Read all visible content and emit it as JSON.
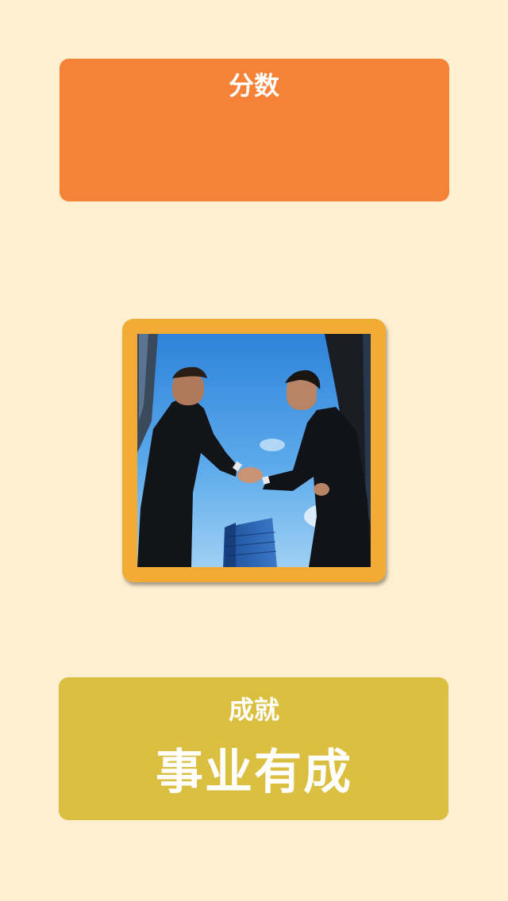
{
  "score_panel": {
    "title": "分数",
    "value": ""
  },
  "photo": {
    "icon": "handshake-photo"
  },
  "achievement_panel": {
    "title": "成就",
    "value": "事业有成"
  },
  "colors": {
    "background": "#feefd0",
    "score_card": "#f58237",
    "photo_frame": "#f2ac36",
    "achievement_card": "#dbbf41",
    "text": "#ffffff"
  }
}
